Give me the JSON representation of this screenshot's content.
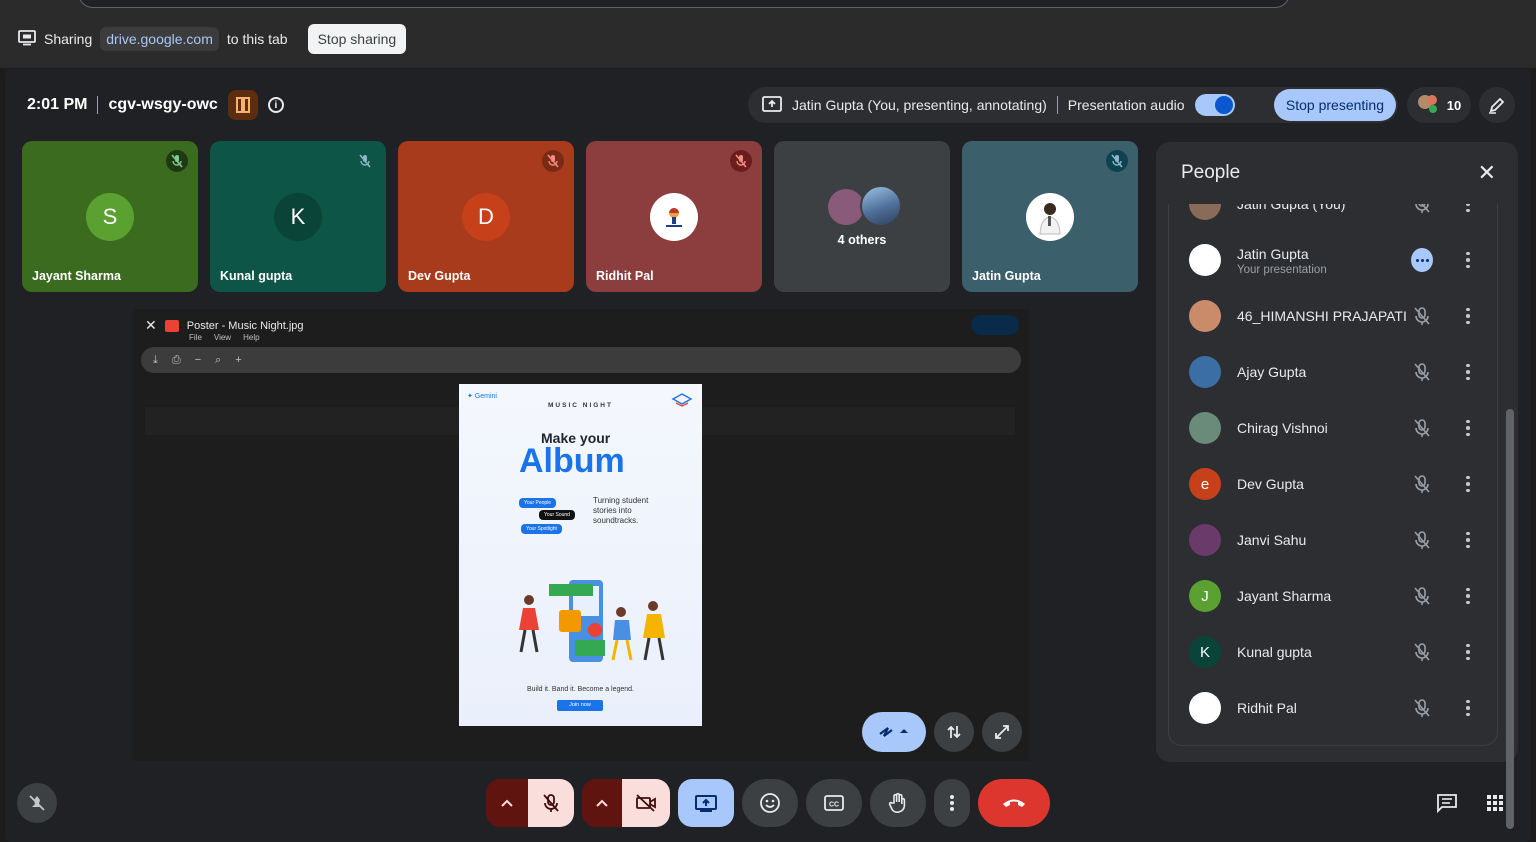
{
  "share_bar": {
    "sharing_label": "Sharing",
    "domain": "drive.google.com",
    "suffix": "to this tab",
    "stop_label": "Stop sharing"
  },
  "meeting": {
    "time": "2:01 PM",
    "code": "cgv-wsgy-owc"
  },
  "presenting": {
    "who": "Jatin Gupta (You, presenting, annotating)",
    "audio_label": "Presentation audio",
    "stop_label": "Stop presenting"
  },
  "people_count": "10",
  "tiles": [
    {
      "name": "Jayant Sharma",
      "initial": "S",
      "bg": "#3b6b1f",
      "avatar_bg": "#5aa132",
      "mic_bg": "#1e3a12"
    },
    {
      "name": "Kunal gupta",
      "initial": "K",
      "bg": "#0d5546",
      "avatar_bg": "#0a4438",
      "mic_bg": "#0d5546"
    },
    {
      "name": "Dev Gupta",
      "initial": "D",
      "bg": "#a73b1b",
      "avatar_bg": "#c6401a",
      "mic_bg": "#7a2a14"
    },
    {
      "name": "Ridhit Pal",
      "initial": "",
      "bg": "#8c3d3d",
      "avatar_bg": "#ffffff",
      "mic_bg": "#6b1c1c"
    },
    {
      "name": "",
      "others": "4 others",
      "bg": "#3c4043"
    },
    {
      "name": "Jatin Gupta",
      "initial": "",
      "bg": "#3c5f6c",
      "avatar_bg": "#ffffff",
      "mic_bg": "#0e4251"
    }
  ],
  "viewer": {
    "file_name": "Poster - Music Night.jpg",
    "menu": [
      "File",
      "View",
      "Help"
    ]
  },
  "poster": {
    "brand": "✦ Gemini",
    "heading": "MUSIC NIGHT",
    "make_your": "Make your",
    "album": "Album",
    "chips": [
      "Your People",
      "Your Sound",
      "Your Spotlight"
    ],
    "tagline": "Turning student stories into soundtracks.",
    "bottom": "Build it. Band it. Become a legend.",
    "join": "Join now"
  },
  "people_panel": {
    "title": "People",
    "rows": [
      {
        "name": "Jatin Gupta (You)",
        "color": "#8a6b5a",
        "partial": true
      },
      {
        "name": "Jatin Gupta",
        "sub": "Your presentation",
        "color": "#ffffff",
        "presenting": true
      },
      {
        "name": "46_HIMANSHI PRAJAPATI",
        "color": "#c98b6a"
      },
      {
        "name": "Ajay Gupta",
        "color": "#3a6ea5"
      },
      {
        "name": "Chirag Vishnoi",
        "color": "#6a8a7a"
      },
      {
        "name": "Dev Gupta",
        "initial": "e",
        "color": "#c6401a"
      },
      {
        "name": "Janvi Sahu",
        "color": "#6a3a6a"
      },
      {
        "name": "Jayant Sharma",
        "initial": "J",
        "color": "#5aa132"
      },
      {
        "name": "Kunal gupta",
        "initial": "K",
        "color": "#0a4438"
      },
      {
        "name": "Ridhit Pal",
        "color": "#ffffff"
      }
    ]
  },
  "colors": {
    "accent": "#a8c7fa",
    "danger": "#ea4335",
    "muted_red": "#f9dedc",
    "panel": "#2d2e31"
  }
}
